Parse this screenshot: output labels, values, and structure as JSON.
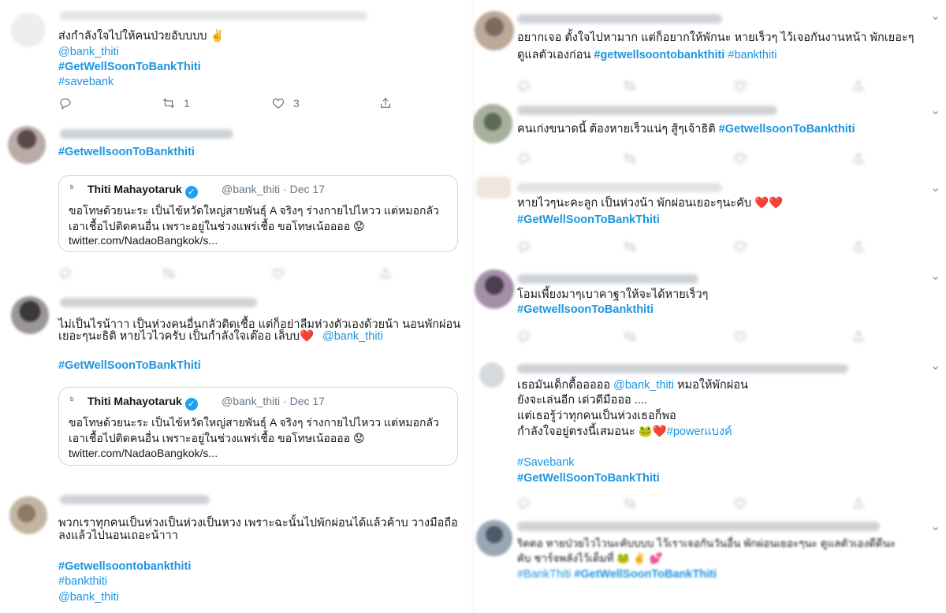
{
  "left": {
    "t1": {
      "text": "ส่งกำลังใจไปให้คนป่วยอับบบบ ✌️",
      "mention": "@bank_thiti",
      "tag1": "#GetWellSoonToBankThiti",
      "tag2": "#savebank",
      "retweets": "1",
      "likes": "3"
    },
    "t2": {
      "tag": "#GetwellsoonToBankthiti",
      "quote": {
        "name": "Thiti Mahayotaruk",
        "handle": "@bank_thiti · Dec 17",
        "line1": "ขอโทษด้วยนะระ เป็นไข้หวัดใหญ่สายพันธุ์ A จริงๆ ร่างกายไปไหวว แต่หมอกลัว",
        "line2": "เอาเชื้อไปติดคนอื่น เพราะอยู่ในช่วงแพร่เชื้อ ขอโทษเน้ออออ 😟",
        "link": "twitter.com/NadaoBangkok/s..."
      }
    },
    "t3": {
      "line1": "ไม่เป็นไรน้าาา เป็นห่วงคนอื่นกลัวติดเชื้อ แต่ก็อย่าลืมห่วงตัวเองด้วยน้า นอนพักผ่อน",
      "line2": "เยอะๆนะธิติ หายไวไวครับ เป็นกำลังใจเต๊ออ เล็บบ",
      "heart": "❤️",
      "mention": "@bank_thiti",
      "tag": "#GetWellSoonToBankThiti",
      "quote": {
        "name": "Thiti Mahayotaruk",
        "handle": "@bank_thiti · Dec 17",
        "line1": "ขอโทษด้วยนะระ เป็นไข้หวัดใหญ่สายพันธุ์ A จริงๆ ร่างกายไปไหวว แต่หมอกลัว",
        "line2": "เอาเชื้อไปติดคนอื่น เพราะอยู่ในช่วงแพร่เชื้อ ขอโทษเน้ออออ 😟",
        "link": "twitter.com/NadaoBangkok/s..."
      }
    },
    "t4": {
      "line1": "พวกเราทุกคนเป็นห่วงเป็นห่วงเป็นหวง เพราะฉะนั้นไปพักผ่อนได้แล้วค้าบ วางมือถือ",
      "line2": "ลงแล้วไปนอนเถอะน้าาา",
      "tag1": "#Getwellsoontobankthiti",
      "tag2": "#bankthiti",
      "mention": "@bank_thiti"
    }
  },
  "right": {
    "r1": {
      "line1": "อยากเจอ ตั้งใจไปหามาก แต่ก็อยากให้พักนะ หายเร็วๆ ไว้เจอกันงานหน้า พักเยอะๆ",
      "line2": "ดูแลตัวเองก่อน",
      "tag1": "#getwellsoontobankthiti",
      "tag2": "#bankthiti"
    },
    "r2": {
      "text": "คนเก่งขนาดนี้ ต้องหายเร็วแน่ๆ สู้ๆเจ้าธิติ",
      "tag": "#GetwellsoonToBankthiti"
    },
    "r3": {
      "text": "หายไวๆนะคะลูก เป็นห่วงน้า พักผ่อนเยอะๆนะคับ",
      "hearts": "❤️❤️",
      "tag": "#GetWellSoonToBankThiti"
    },
    "r4": {
      "text": "โอมเพี้ยงมาๆเบาคาฐาให้จะได้หายเร็วๆ",
      "tag": "#GetwellsoonToBankthiti"
    },
    "r5": {
      "line1a": "เธอมันเด็กดื้อออออ",
      "mention": "@bank_thiti",
      "line1b": "หมอให้พักผ่อน",
      "line2": "ยังจะเล่นอีก เด่วดีมือออ ....",
      "line3": "แต่เธอรู้ว่าทุกคนเป็นห่วงเธอก็พอ",
      "line4": "กำลังใจอยู่ตรงนี้เสมอนะ 🐸❤️",
      "tag_inline": "#powerแบงค์",
      "tag1": "#Savebank",
      "tag2": "#GetWellSoonToBankThiti"
    },
    "r6": {
      "line1": "ริตตอ หายป่วยไวไวนะคับบบบ ไว้เราเจอกันวันอื่น พักผ่อนเยอะๆนะ ดูแลตัวเองดีดีนะ",
      "line2": "คับ ชาร์จพลังไว้เต็มที่ 🐸 ✌️ 💕",
      "tag1": "#BankThiti",
      "tag2": "#GetWellSoonToBankThiti"
    }
  },
  "icons": {
    "reply": "reply-icon",
    "retweet": "retweet-icon",
    "like": "heart-icon",
    "share": "share-icon",
    "chevron": "chevron-down-icon"
  },
  "colors": {
    "link": "#1b95e0",
    "text": "#14171a",
    "muted": "#657786",
    "heart": "#e0245e",
    "verified": "#1da1f2"
  }
}
